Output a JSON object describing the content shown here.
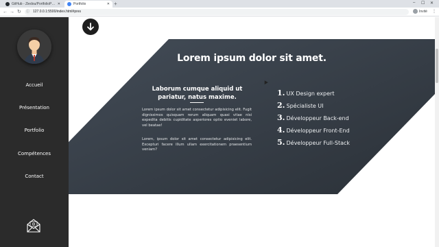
{
  "browser": {
    "tabs": [
      {
        "label": "GitHub - Ziedou/PortfolioProjec...",
        "active": false,
        "favicon_color": "#24292e"
      },
      {
        "label": "Portfolio",
        "active": true,
        "favicon_color": "#4285f4"
      }
    ],
    "url": "127.0.0.1:5500/index.html#pres",
    "profile_name": "Invité",
    "nav_icons": [
      "back-icon",
      "forward-icon",
      "reload-icon"
    ]
  },
  "sidebar": {
    "nav": [
      "Accueil",
      "Présentation",
      "Portfolio",
      "Compétences",
      "Contact"
    ]
  },
  "hero": {
    "title": "Lorem ipsum dolor sit amet.",
    "subheading": "Laborum cumque aliquid ut pariatur, natus maxime.",
    "paragraph1": "Lorem ipsum dolor sit amet consectetur adipisicing elit. Fugit dignissimos quisquam rerum aliquam quasi vitae nisi expedita debitis cupiditate asperiores optio eveniet labore, vel beatae!",
    "paragraph2": "Lorem, ipsum dolor sit amet consectetur adipisicing elit. Excepturi facere illum ullam exercitationem praesentium veniam?",
    "list": [
      {
        "num": "1.",
        "text": "UX Design expert"
      },
      {
        "num": "2.",
        "text": "Spécialiste UI"
      },
      {
        "num": "3.",
        "text": "Développeur Back-end"
      },
      {
        "num": "4.",
        "text": "Développeur Front-End"
      },
      {
        "num": "5.",
        "text": "Développeur Full-Stack"
      }
    ]
  },
  "colors": {
    "sidebar_bg": "#2b2b2b",
    "hero_gradient_start": "#3f4853",
    "hero_gradient_end": "#2d343c",
    "tab_bar_bg": "#dee1e6"
  }
}
